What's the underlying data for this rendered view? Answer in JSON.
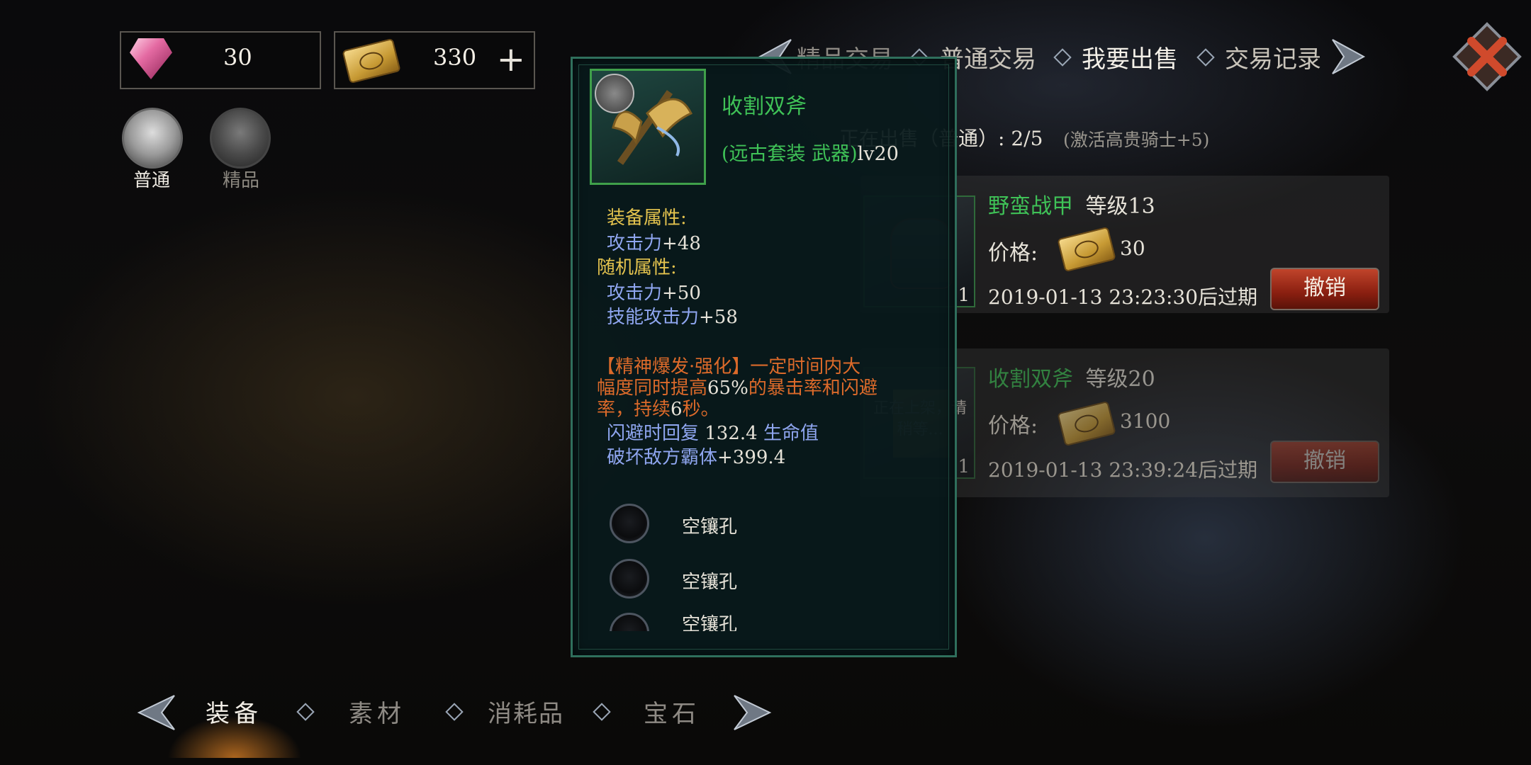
{
  "currency": {
    "gem_icon": "pink-diamond-icon",
    "gem_amount": "30",
    "ticket_icon": "gold-ticket-icon",
    "ticket_amount": "330",
    "add_label": "+"
  },
  "categories": [
    {
      "label": "普通",
      "icon": "money-bag-hand-icon"
    },
    {
      "label": "精品",
      "icon": "sparkle-hands-icon"
    }
  ],
  "top_tabs": [
    {
      "label": "精品交易"
    },
    {
      "label": "普通交易"
    },
    {
      "label": "我要出售",
      "active": true
    },
    {
      "label": "交易记录"
    }
  ],
  "selling_status": "正在出售（普通）: 2/5",
  "selling_bonus": "(激活高贵骑士+5)",
  "listings": [
    {
      "name": "野蛮战甲",
      "level": "等级13",
      "price_label": "价格:",
      "price": "30",
      "count": "1",
      "expire": "2019-01-13 23:23:30后过期",
      "cancel_label": "撤销"
    },
    {
      "name": "收割双斧",
      "level": "等级20",
      "price_label": "价格:",
      "price": "3100",
      "count": "1",
      "pending": "正在上架，请稍等...",
      "expire": "2019-01-13 23:39:24后过期",
      "cancel_label": "撤销"
    }
  ],
  "tooltip": {
    "item_name": "收割双斧",
    "item_type": "(远古套装 武器)",
    "item_level": "lv20",
    "equip_attr_title": "装备属性:",
    "equip_attr": [
      {
        "name": "攻击力",
        "value": "+48"
      }
    ],
    "random_attr_title": "随机属性:",
    "random_attr": [
      {
        "name": "攻击力",
        "value": "+50"
      },
      {
        "name": "技能攻击力",
        "value": "+58"
      }
    ],
    "skill_line1": "【精神爆发·强化】一定时间内大",
    "skill_line2_a": "幅度同时提高",
    "skill_line2_b": "65%",
    "skill_line2_c": "的暴击率和闪避",
    "skill_line3_a": "率，持续",
    "skill_line3_b": "6",
    "skill_line3_c": "秒。",
    "extra1_a": "闪避时回复 ",
    "extra1_b": "132.4",
    "extra1_c": " 生命值",
    "extra2_a": "破坏敌方霸体",
    "extra2_b": "+399.4",
    "sockets": [
      "空镶孔",
      "空镶孔",
      "空镶孔"
    ]
  },
  "bottom_tabs": [
    {
      "label": "装备",
      "active": true
    },
    {
      "label": "素材"
    },
    {
      "label": "消耗品"
    },
    {
      "label": "宝石"
    }
  ],
  "colors": {
    "item_green": "#3fc257",
    "attr_yellow": "#e4c34e",
    "attr_blue": "#8fa6f0",
    "skill_orange": "#dc6a2a",
    "cancel_red": "#a8321d"
  }
}
